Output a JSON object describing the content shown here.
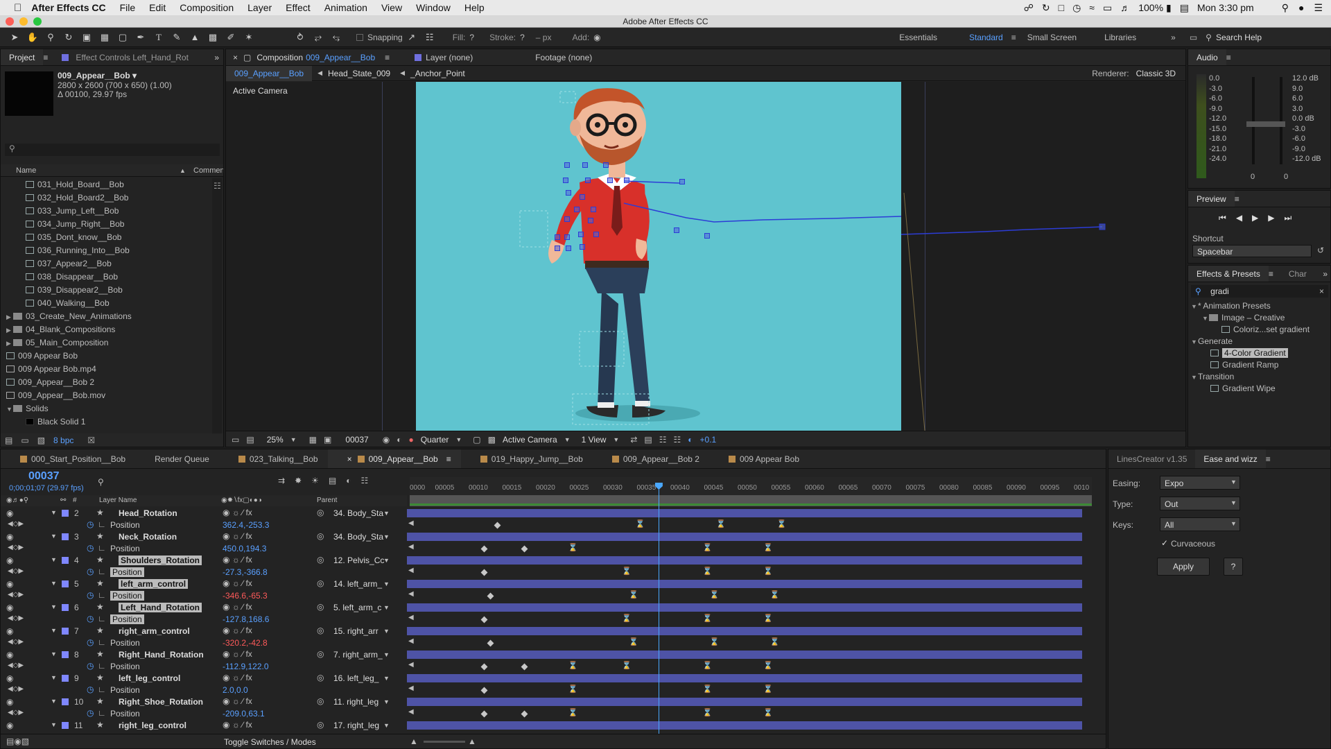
{
  "menubar": {
    "app_name": "After Effects CC",
    "items": [
      "File",
      "Edit",
      "Composition",
      "Layer",
      "Effect",
      "Animation",
      "View",
      "Window",
      "Help"
    ],
    "battery": "100%",
    "clock": "Mon 3:30 pm"
  },
  "window_title": "Adobe After Effects CC",
  "toolbar": {
    "snapping": "Snapping",
    "fill": "Fill:",
    "stroke": "Stroke:",
    "px": "– px",
    "add": "Add:",
    "workspaces": [
      "Essentials",
      "Standard",
      "Small Screen",
      "Libraries"
    ],
    "search_help": "Search Help"
  },
  "project": {
    "tab_project": "Project",
    "tab_effect_controls": "Effect Controls Left_Hand_Rot",
    "item_name": "009_Appear__Bob ▾",
    "item_size": "2800 x 2600  (700 x 650) (1.00)",
    "item_duration": "Δ 00100, 29.97 fps",
    "col_name": "Name",
    "col_comment": "Comment",
    "items": [
      {
        "label": "031_Hold_Board__Bob",
        "kind": "comp",
        "indent": 1
      },
      {
        "label": "032_Hold_Board2__Bob",
        "kind": "comp",
        "indent": 1
      },
      {
        "label": "033_Jump_Left__Bob",
        "kind": "comp",
        "indent": 1
      },
      {
        "label": "034_Jump_Right__Bob",
        "kind": "comp",
        "indent": 1
      },
      {
        "label": "035_Dont_know__Bob",
        "kind": "comp",
        "indent": 1
      },
      {
        "label": "036_Running_Into__Bob",
        "kind": "comp",
        "indent": 1
      },
      {
        "label": "037_Appear2__Bob",
        "kind": "comp",
        "indent": 1
      },
      {
        "label": "038_Disappear__Bob",
        "kind": "comp",
        "indent": 1
      },
      {
        "label": "039_Disappear2__Bob",
        "kind": "comp",
        "indent": 1
      },
      {
        "label": "040_Walking__Bob",
        "kind": "comp",
        "indent": 1
      },
      {
        "label": "03_Create_New_Animations",
        "kind": "folder",
        "indent": 0
      },
      {
        "label": "04_Blank_Compositions",
        "kind": "folder",
        "indent": 0
      },
      {
        "label": "05_Main_Composition",
        "kind": "folder",
        "indent": 0
      },
      {
        "label": "009 Appear Bob",
        "kind": "comp",
        "indent": 0
      },
      {
        "label": "009 Appear Bob.mp4",
        "kind": "file",
        "indent": 0
      },
      {
        "label": "009_Appear__Bob 2",
        "kind": "comp",
        "indent": 0
      },
      {
        "label": "009_Appear__Bob.mov",
        "kind": "file",
        "indent": 0
      },
      {
        "label": "Solids",
        "kind": "folder-open",
        "indent": 0
      },
      {
        "label": "Black Solid 1",
        "kind": "solid",
        "indent": 1
      }
    ],
    "bpc": "8 bpc"
  },
  "comp": {
    "tab_comp_prefix": "Composition",
    "tab_comp_name": "009_Appear__Bob",
    "tab_layer": "Layer (none)",
    "tab_footage": "Footage (none)",
    "breadcrumbs": [
      "009_Appear__Bob",
      "Head_State_009",
      "_Anchor_Point"
    ],
    "renderer_label": "Renderer:",
    "renderer_value": "Classic 3D",
    "view_label": "Active Camera",
    "bg_color": "#5fc4cf",
    "footer": {
      "zoom": "25%",
      "frame": "00037",
      "resolution": "Quarter",
      "camera": "Active Camera",
      "views": "1 View",
      "exposure": "+0.1"
    }
  },
  "audio": {
    "title": "Audio",
    "left_scale": [
      "0.0",
      "-3.0",
      "-6.0",
      "-9.0",
      "-12.0",
      "-15.0",
      "-18.0",
      "-21.0",
      "-24.0"
    ],
    "right_scale": [
      "12.0 dB",
      "9.0",
      "6.0",
      "3.0",
      "0.0 dB",
      "-3.0",
      "-6.0",
      "-9.0",
      "-12.0 dB"
    ],
    "zeros": [
      "0",
      "0"
    ]
  },
  "preview": {
    "title": "Preview",
    "shortcut_label": "Shortcut",
    "shortcut_value": "Spacebar"
  },
  "effects": {
    "tab": "Effects & Presets",
    "tab2": "Char",
    "search": "gradi",
    "tree": [
      {
        "label": "* Animation Presets",
        "indent": 0,
        "type": "group"
      },
      {
        "label": "Image – Creative",
        "indent": 1,
        "type": "folder"
      },
      {
        "label": "Coloriz...set gradient",
        "indent": 2,
        "type": "preset"
      },
      {
        "label": "Generate",
        "indent": 0,
        "type": "group"
      },
      {
        "label": "4-Color Gradient",
        "indent": 1,
        "type": "effect",
        "selected": true
      },
      {
        "label": "Gradient Ramp",
        "indent": 1,
        "type": "effect"
      },
      {
        "label": "Transition",
        "indent": 0,
        "type": "group"
      },
      {
        "label": "Gradient Wipe",
        "indent": 1,
        "type": "effect"
      }
    ]
  },
  "timeline": {
    "tabs": [
      {
        "label": "000_Start_Position__Bob",
        "color": "#b98a4a"
      },
      {
        "label": "Render Queue",
        "color": ""
      },
      {
        "label": "023_Talking__Bob",
        "color": "#b98a4a"
      },
      {
        "label": "009_Appear__Bob",
        "color": "#b98a4a",
        "active": true
      },
      {
        "label": "019_Happy_Jump__Bob",
        "color": "#b98a4a"
      },
      {
        "label": "009_Appear__Bob 2",
        "color": "#b98a4a"
      },
      {
        "label": "009 Appear Bob",
        "color": "#b98a4a"
      }
    ],
    "current_time": "00037",
    "timecode": "0;00;01;07 (29.97 fps)",
    "col_hash": "#",
    "col_layer_name": "Layer Name",
    "col_parent": "Parent",
    "ruler": [
      "0000",
      "00005",
      "00010",
      "00015",
      "00020",
      "00025",
      "00030",
      "00035",
      "00040",
      "00045",
      "00050",
      "00055",
      "00060",
      "00065",
      "00070",
      "00075",
      "00080",
      "00085",
      "00090",
      "00095",
      "0010"
    ],
    "playhead_frame": 37,
    "total_frames": 100,
    "toggle": "Toggle Switches / Modes",
    "layers": [
      {
        "num": "2",
        "name": "Head_Rotation",
        "parent": "34. Body_Sta",
        "pos": "362.4,-253.3",
        "pos_red": false,
        "sel": false,
        "keys": [
          13
        ],
        "eases": [
          34,
          46,
          55
        ]
      },
      {
        "num": "3",
        "name": "Neck_Rotation",
        "parent": "34. Body_Sta",
        "pos": "450.0,194.3",
        "pos_red": false,
        "sel": false,
        "keys": [
          11,
          17
        ],
        "eases": [
          24,
          44,
          53
        ]
      },
      {
        "num": "4",
        "name": "Shoulders_Rotation",
        "parent": "12. Pelvis_Cc",
        "pos": "-27.3,-366.8",
        "pos_red": false,
        "sel": true,
        "keys": [
          11
        ],
        "eases": [
          32,
          44,
          53
        ],
        "sel_eases": true
      },
      {
        "num": "5",
        "name": "left_arm_control",
        "parent": "14. left_arm_",
        "pos": "-346.6,-65.3",
        "pos_red": true,
        "sel": true,
        "keys": [
          12
        ],
        "eases": [
          33,
          45,
          54
        ],
        "sel_eases": true
      },
      {
        "num": "6",
        "name": "Left_Hand_Rotation",
        "parent": "5. left_arm_c",
        "pos": "-127.8,168.6",
        "pos_red": false,
        "sel": true,
        "keys": [
          11
        ],
        "eases": [
          32,
          44,
          53
        ]
      },
      {
        "num": "7",
        "name": "right_arm_control",
        "parent": "15. right_arr",
        "pos": "-320.2,-42.8",
        "pos_red": true,
        "sel": false,
        "keys": [
          12
        ],
        "eases": [
          33,
          45,
          54
        ]
      },
      {
        "num": "8",
        "name": "Right_Hand_Rotation",
        "parent": "7. right_arm_",
        "pos": "-112.9,122.0",
        "pos_red": false,
        "sel": false,
        "keys": [
          11,
          17
        ],
        "eases": [
          24,
          32,
          44,
          53
        ]
      },
      {
        "num": "9",
        "name": "left_leg_control",
        "parent": "16. left_leg_",
        "pos": "2.0,0.0",
        "pos_red": false,
        "sel": false,
        "keys": [
          11
        ],
        "eases": [
          24,
          44,
          53
        ]
      },
      {
        "num": "10",
        "name": "Right_Shoe_Rotation",
        "parent": "11. right_leg",
        "pos": "-209.0,63.1",
        "pos_red": false,
        "sel": false,
        "keys": [
          11,
          17
        ],
        "eases": [
          24,
          44,
          53
        ]
      },
      {
        "num": "11",
        "name": "right_leg_control",
        "parent": "17. right_leg",
        "pos": "",
        "pos_red": false,
        "sel": false,
        "keys": [],
        "eases": []
      }
    ],
    "position_label": "Position"
  },
  "ease_panel": {
    "tab1": "LinesCreator v1.35",
    "tab2": "Ease and wizz",
    "easing_label": "Easing:",
    "easing_value": "Expo",
    "type_label": "Type:",
    "type_value": "Out",
    "keys_label": "Keys:",
    "keys_value": "All",
    "curvaceous": "Curvaceous",
    "apply": "Apply",
    "help": "?"
  }
}
